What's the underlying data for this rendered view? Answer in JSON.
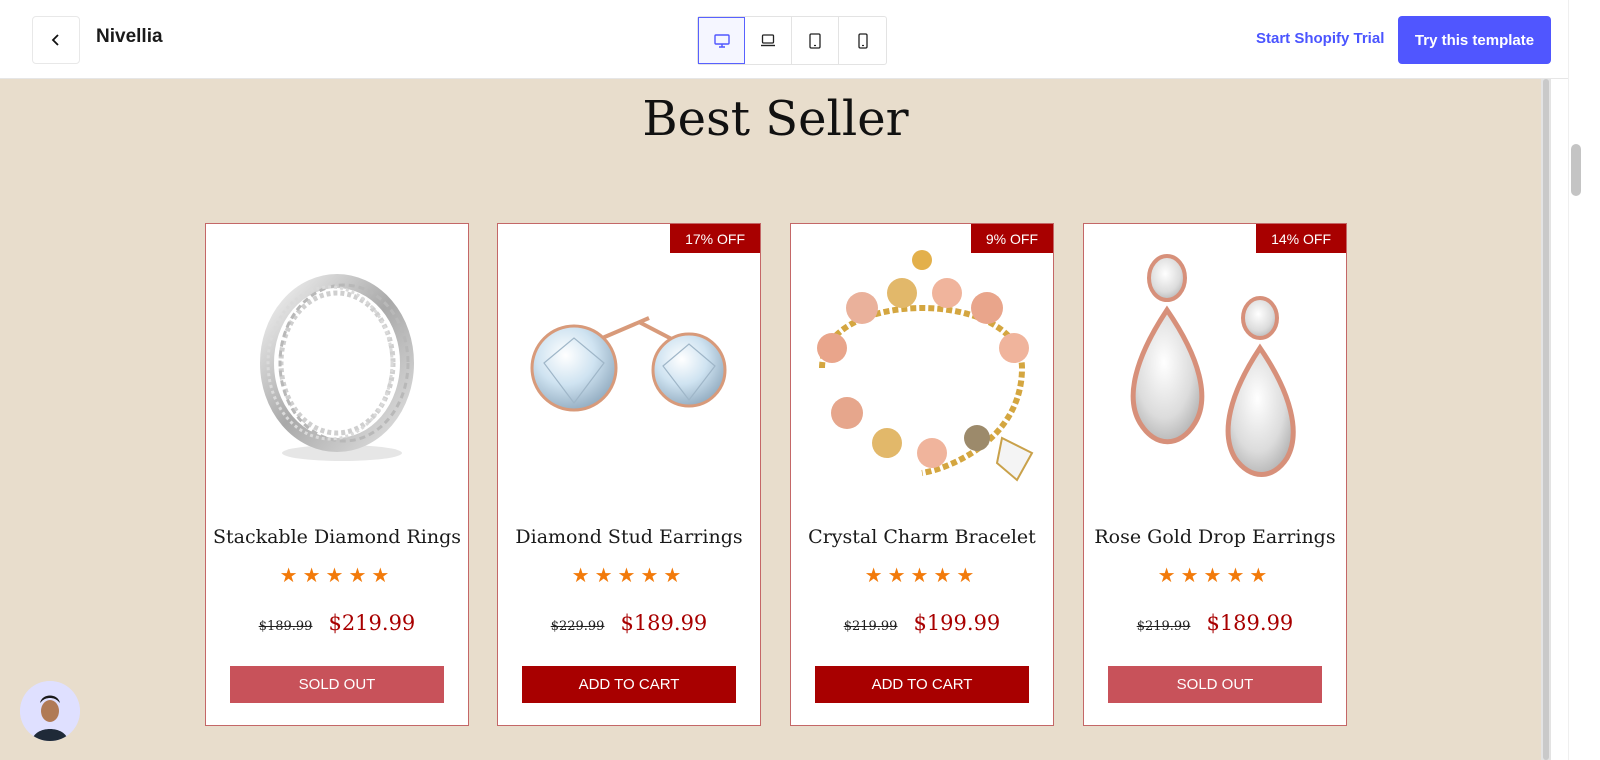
{
  "header": {
    "brand": "Nivellia",
    "device_icons": [
      "desktop-icon",
      "laptop-icon",
      "tablet-icon",
      "mobile-icon"
    ],
    "active_device": "desktop",
    "trial_link": "Start Shopify Trial",
    "try_button": "Try this template"
  },
  "colors": {
    "accent": "#5056ff",
    "page_bg": "#e8ddcc",
    "sale_red": "#a80000",
    "sold_out": "#c8525a",
    "star": "#f27a0a"
  },
  "section": {
    "title": "Best Seller"
  },
  "products": [
    {
      "name": "Stackable Diamond Rings",
      "badge": "",
      "rating": 5,
      "old_price": "$189.99",
      "price": "$219.99",
      "cta": "SOLD OUT",
      "cta_state": "sold",
      "image": "ring-image"
    },
    {
      "name": "Diamond Stud Earrings",
      "badge": "17% OFF",
      "rating": 5,
      "old_price": "$229.99",
      "price": "$189.99",
      "cta": "ADD TO CART",
      "cta_state": "add",
      "image": "stud-earrings-image"
    },
    {
      "name": "Crystal Charm Bracelet",
      "badge": "9% OFF",
      "rating": 5,
      "old_price": "$219.99",
      "price": "$199.99",
      "cta": "ADD TO CART",
      "cta_state": "add",
      "image": "bracelet-image"
    },
    {
      "name": "Rose Gold Drop Earrings",
      "badge": "14% OFF",
      "rating": 5,
      "old_price": "$219.99",
      "price": "$189.99",
      "cta": "SOLD OUT",
      "cta_state": "sold",
      "image": "drop-earrings-image"
    }
  ]
}
